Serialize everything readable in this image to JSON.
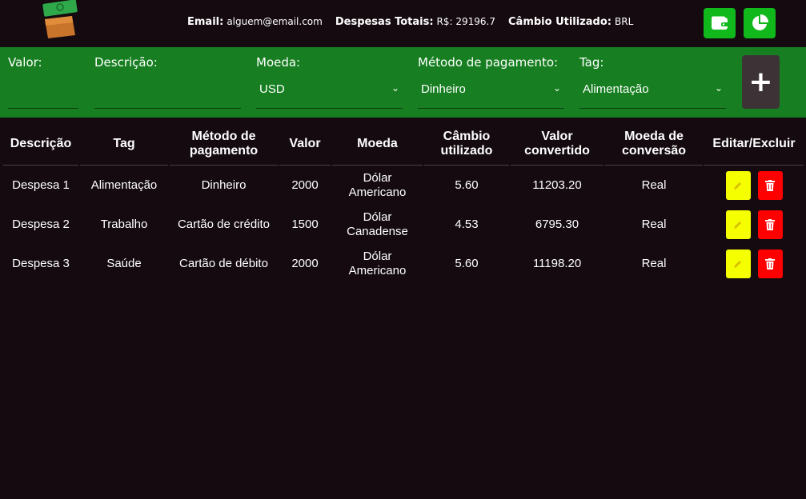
{
  "header": {
    "email_label": "Email:",
    "email_value": "alguem@email.com",
    "total_label": "Despesas Totais:",
    "total_value": "R$: 29196.7",
    "currency_label": "Câmbio Utilizado:",
    "currency_value": "BRL"
  },
  "form": {
    "valor_label": "Valor:",
    "descricao_label": "Descrição:",
    "moeda_label": "Moeda:",
    "moeda_value": "USD",
    "metodo_label": "Método de pagamento:",
    "metodo_value": "Dinheiro",
    "tag_label": "Tag:",
    "tag_value": "Alimentação",
    "add_label": "+"
  },
  "table": {
    "headers": [
      "Descrição",
      "Tag",
      "Método de pagamento",
      "Valor",
      "Moeda",
      "Câmbio utilizado",
      "Valor convertido",
      "Moeda de conversão",
      "Editar/Excluir"
    ],
    "rows": [
      [
        "Despesa 1",
        "Alimentação",
        "Dinheiro",
        "2000",
        "Dólar Americano",
        "5.60",
        "11203.20",
        "Real"
      ],
      [
        "Despesa 2",
        "Trabalho",
        "Cartão de crédito",
        "1500",
        "Dólar Canadense",
        "4.53",
        "6795.30",
        "Real"
      ],
      [
        "Despesa 3",
        "Saúde",
        "Cartão de débito",
        "2000",
        "Dólar Americano",
        "5.60",
        "11198.20",
        "Real"
      ]
    ]
  },
  "colors": {
    "background": "#140a0f",
    "form_bar": "#177f21",
    "header_button": "#10b81c",
    "edit_button": "#f5ff00",
    "delete_button": "#ff0000"
  },
  "icons": {
    "logo": "money-wallet-logo",
    "wallet": "wallet-icon",
    "chart": "pie-chart-icon",
    "edit": "pencil-icon",
    "delete": "trash-icon"
  }
}
